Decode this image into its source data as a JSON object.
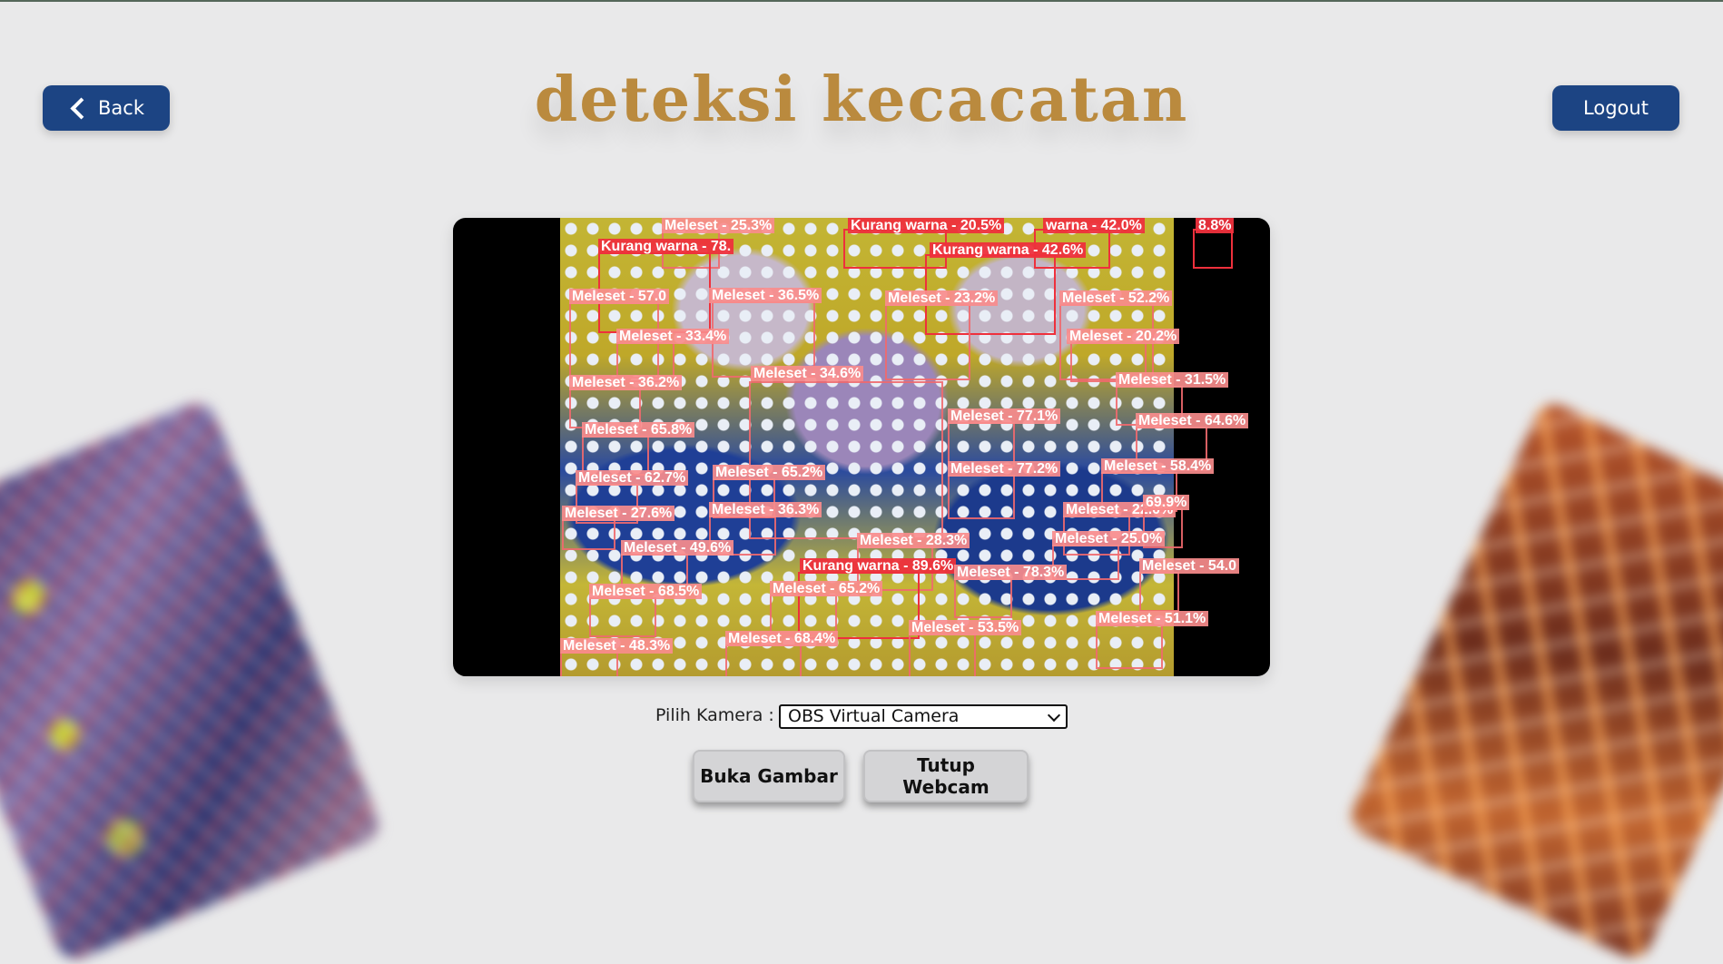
{
  "header": {
    "title": "deteksi kecacatan",
    "back_label": "Back",
    "logout_label": "Logout"
  },
  "video": {
    "detections": [
      {
        "label": "Meleset - 25.3%",
        "strong": false
      },
      {
        "label": "Kurang warna - 20.5%",
        "strong": true
      },
      {
        "label": "warna - 42.0%",
        "strong": true
      },
      {
        "label": "8.8%",
        "strong": true
      },
      {
        "label": "Kurang warna - 78.",
        "strong": true
      },
      {
        "label": "Kurang warna - 42.6%",
        "strong": true
      },
      {
        "label": "Meleset - 57.0",
        "strong": false
      },
      {
        "label": "Meleset - 36.5%",
        "strong": false
      },
      {
        "label": "Meleset - 23.2%",
        "strong": false
      },
      {
        "label": "Meleset - 52.2%",
        "strong": false
      },
      {
        "label": "Meleset - 33.4%",
        "strong": false
      },
      {
        "label": "Meleset - 20.2%",
        "strong": false
      },
      {
        "label": "Meleset - 36.2%",
        "strong": false
      },
      {
        "label": "Meleset - 34.6%",
        "strong": false
      },
      {
        "label": "Meleset - 31.5%",
        "strong": false
      },
      {
        "label": "Meleset - 77.1%",
        "strong": false
      },
      {
        "label": "Meleset - 65.8%",
        "strong": false
      },
      {
        "label": "Meleset - 64.6%",
        "strong": false
      },
      {
        "label": "Meleset - 62.7%",
        "strong": false
      },
      {
        "label": "Meleset - 65.2%",
        "strong": false
      },
      {
        "label": "Meleset - 77.2%",
        "strong": false
      },
      {
        "label": "Meleset - 58.4%",
        "strong": false
      },
      {
        "label": "Meleset - 27.6%",
        "strong": false
      },
      {
        "label": "Meleset - 36.3%",
        "strong": false
      },
      {
        "label": "Meleset - 22.0%",
        "strong": false
      },
      {
        "label": "69.9%",
        "strong": false
      },
      {
        "label": "Meleset - 49.6%",
        "strong": false
      },
      {
        "label": "Meleset - 28.3%",
        "strong": false
      },
      {
        "label": "Meleset - 25.0%",
        "strong": false
      },
      {
        "label": "Kurang warna - 89.6%",
        "strong": true
      },
      {
        "label": "Meleset - 78.3%",
        "strong": false
      },
      {
        "label": "Meleset - 54.0",
        "strong": false
      },
      {
        "label": "Meleset - 68.5%",
        "strong": false
      },
      {
        "label": "Meleset - 65.2%",
        "strong": false
      },
      {
        "label": "Meleset - 53.5%",
        "strong": false
      },
      {
        "label": "Meleset - 51.1%",
        "strong": false
      },
      {
        "label": "Meleset - 48.3%",
        "strong": false
      },
      {
        "label": "Meleset - 68.4%",
        "strong": false
      }
    ]
  },
  "camera": {
    "label": "Pilih Kamera :",
    "selected": "OBS Virtual Camera"
  },
  "actions": {
    "open_label": "Buka Gambar",
    "close_label": "Tutup Webcam"
  },
  "colors": {
    "primary": "#1c4483",
    "title": "#ba8a3e",
    "background": "#e9e9ea",
    "detection_box": "#ef696e",
    "detection_strong": "#ee303c"
  }
}
